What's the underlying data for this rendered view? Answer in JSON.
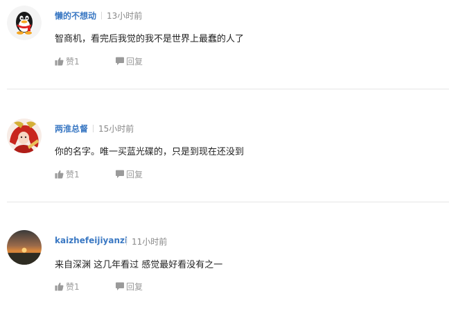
{
  "comments": [
    {
      "username": "懒的不想动",
      "time": "13小时前",
      "content": "智商机，看完后我觉的我不是世界上最蠢的人了",
      "like_label": "赞1",
      "reply_label": "回复",
      "avatar": "qq-penguin-avatar"
    },
    {
      "username": "两淮总督",
      "time": "15小时前",
      "content": "你的名字。唯一买蓝光碟的，只是到现在还没到",
      "like_label": "赞1",
      "reply_label": "回复",
      "avatar": "anime-character-avatar"
    },
    {
      "username": "kaizhefeijiyanzi",
      "time": "11小时前",
      "content": "来自深渊 这几年看过 感觉最好看没有之一",
      "like_label": "赞1",
      "reply_label": "回复",
      "avatar": "sunset-photo-avatar"
    }
  ],
  "colors": {
    "username": "#3a78c3",
    "time": "#888888",
    "action": "#999999",
    "divider": "#e6e6e6"
  }
}
